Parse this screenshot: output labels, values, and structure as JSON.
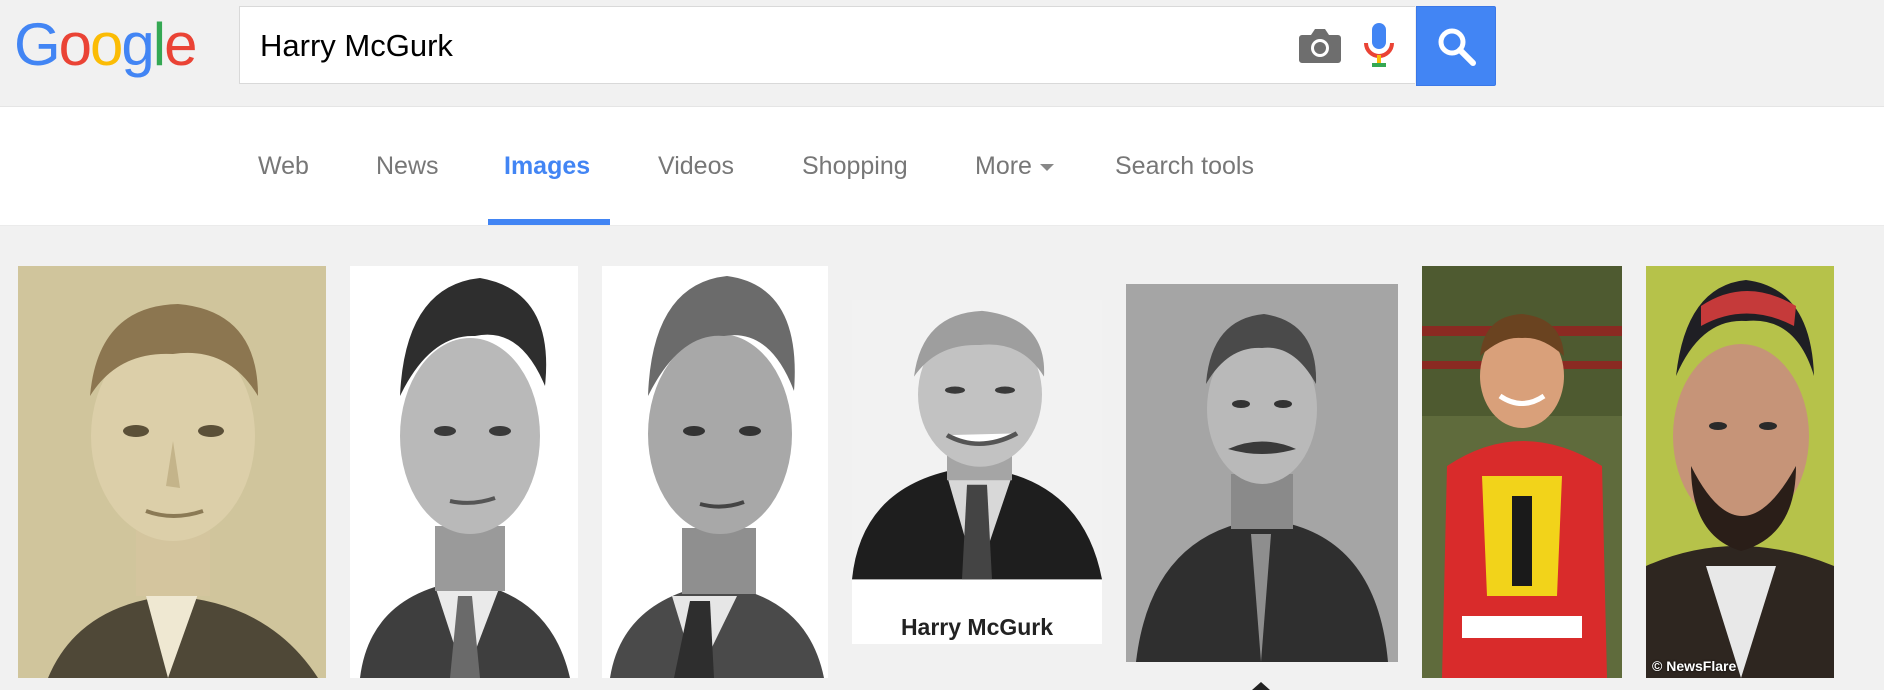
{
  "logo": {
    "letters": [
      "G",
      "o",
      "o",
      "g",
      "l",
      "e"
    ],
    "colors": [
      "#4285f4",
      "#ea4335",
      "#fbbc05",
      "#4285f4",
      "#34a853",
      "#ea4335"
    ]
  },
  "search": {
    "value": "Harry McGurk",
    "camera_icon": "camera-icon",
    "mic_icon": "microphone-icon",
    "button_icon": "search-icon"
  },
  "tabs": [
    {
      "label": "Web"
    },
    {
      "label": "News"
    },
    {
      "label": "Images",
      "active": true
    },
    {
      "label": "Videos"
    },
    {
      "label": "Shopping"
    },
    {
      "label": "More"
    },
    {
      "label": "Search tools"
    }
  ],
  "results": [
    {
      "name": "result-image-1"
    },
    {
      "name": "result-image-2"
    },
    {
      "name": "result-image-3"
    },
    {
      "name": "result-image-4",
      "caption": "Harry McGurk"
    },
    {
      "name": "result-image-5"
    },
    {
      "name": "result-image-6"
    },
    {
      "name": "result-image-7",
      "watermark": "© NewsFlare"
    }
  ],
  "colors": {
    "accent": "#4285f4",
    "tab_text": "#777777",
    "background": "#f1f1f1"
  }
}
